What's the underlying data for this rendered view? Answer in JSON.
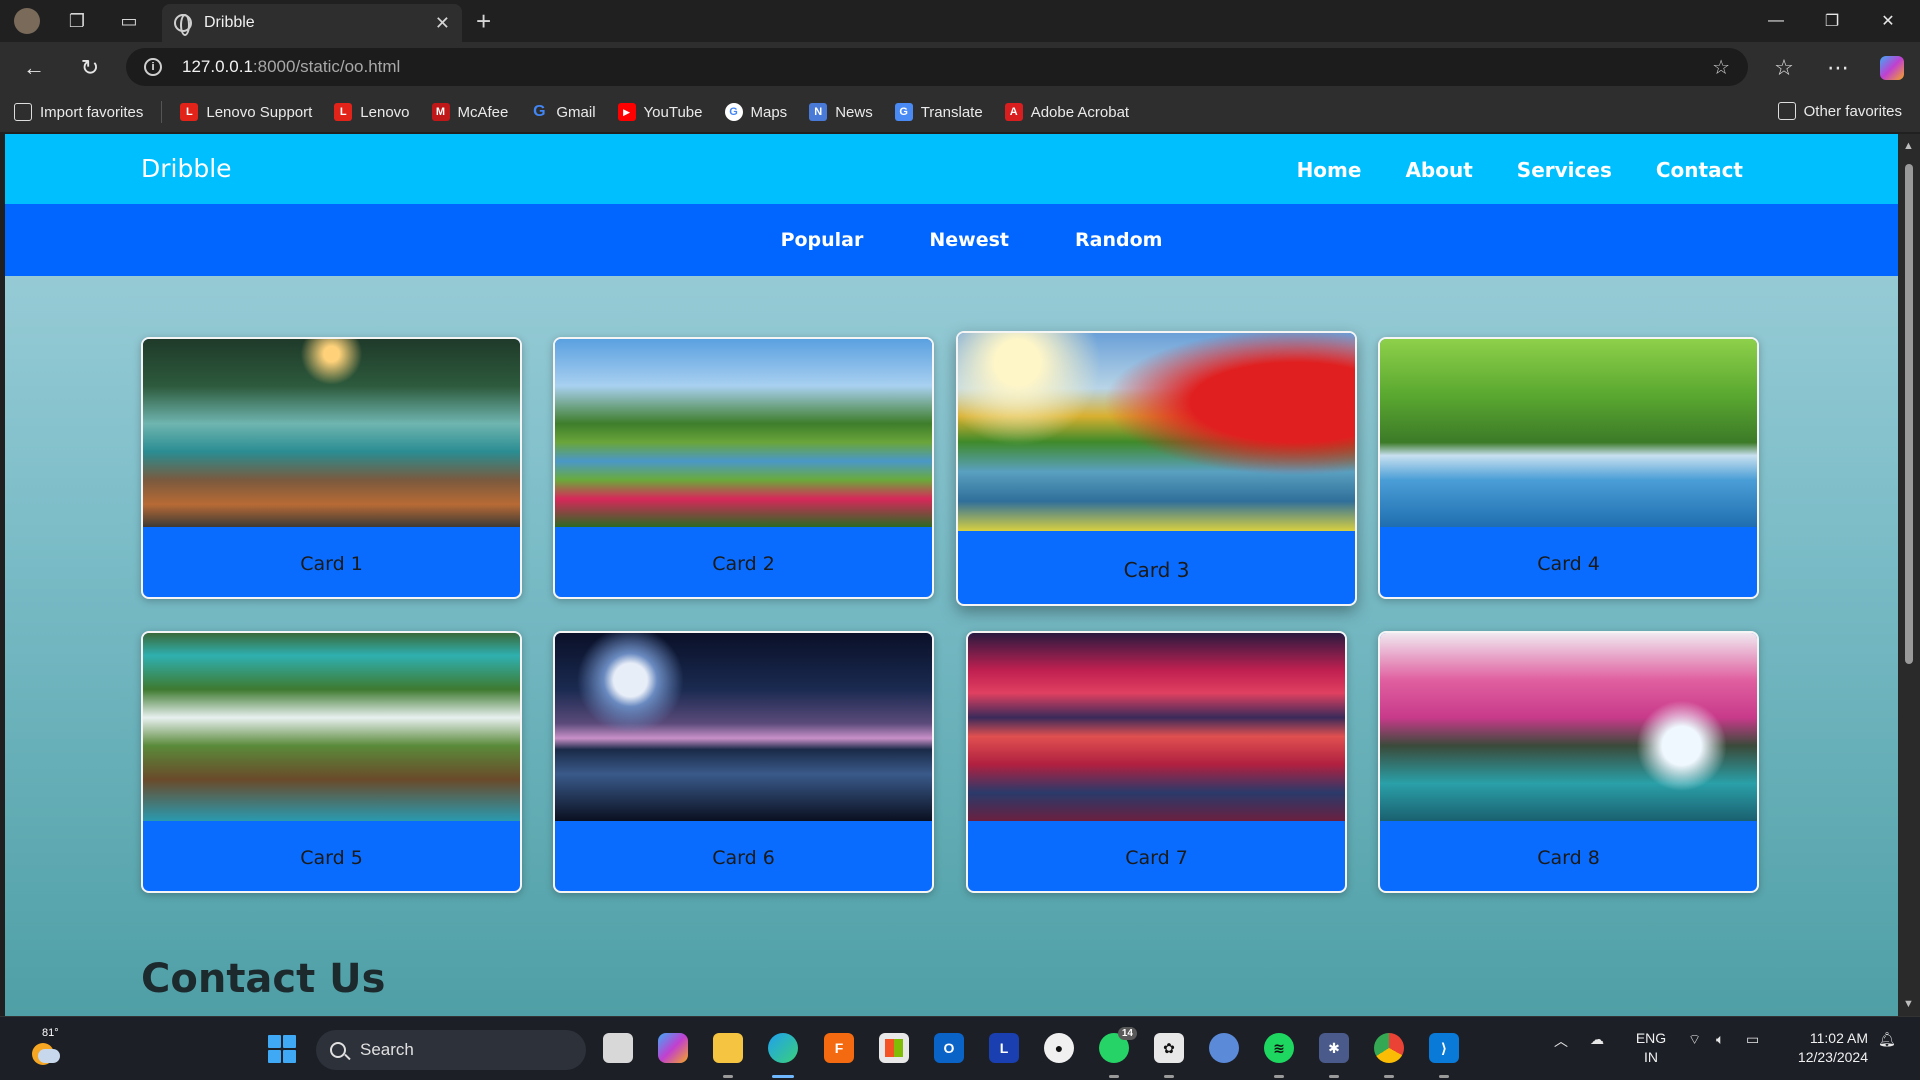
{
  "browser": {
    "tab_title": "Dribble",
    "url_host": "127.0.0.1",
    "url_path": ":8000/static/oo.html",
    "favorites": [
      {
        "label": "Import favorites",
        "icon": "import-icon"
      },
      {
        "label": "Lenovo Support",
        "icon": "lenovo-icon"
      },
      {
        "label": "Lenovo",
        "icon": "lenovo-icon"
      },
      {
        "label": "McAfee",
        "icon": "mcafee-icon"
      },
      {
        "label": "Gmail",
        "icon": "google-icon"
      },
      {
        "label": "YouTube",
        "icon": "youtube-icon"
      },
      {
        "label": "Maps",
        "icon": "maps-icon"
      },
      {
        "label": "News",
        "icon": "news-icon"
      },
      {
        "label": "Translate",
        "icon": "translate-icon"
      },
      {
        "label": "Adobe Acrobat",
        "icon": "acrobat-icon"
      }
    ],
    "other_favorites": "Other favorites"
  },
  "site": {
    "brand": "Dribble",
    "nav": [
      "Home",
      "About",
      "Services",
      "Contact"
    ],
    "subnav": [
      "Popular",
      "Newest",
      "Random"
    ],
    "cards": [
      "Card 1",
      "Card 2",
      "Card 3",
      "Card 4",
      "Card 5",
      "Card 6",
      "Card 7",
      "Card 8"
    ],
    "contact_title": "Contact Us",
    "colors": {
      "header": "#00bfff",
      "subnav": "#0066ff",
      "card": "#0a6cff"
    }
  },
  "taskbar": {
    "weather_temp": "81°",
    "search_placeholder": "Search",
    "whatsapp_badge": "14",
    "lang_line1": "ENG",
    "lang_line2": "IN",
    "time": "11:02 AM",
    "date": "12/23/2024"
  }
}
